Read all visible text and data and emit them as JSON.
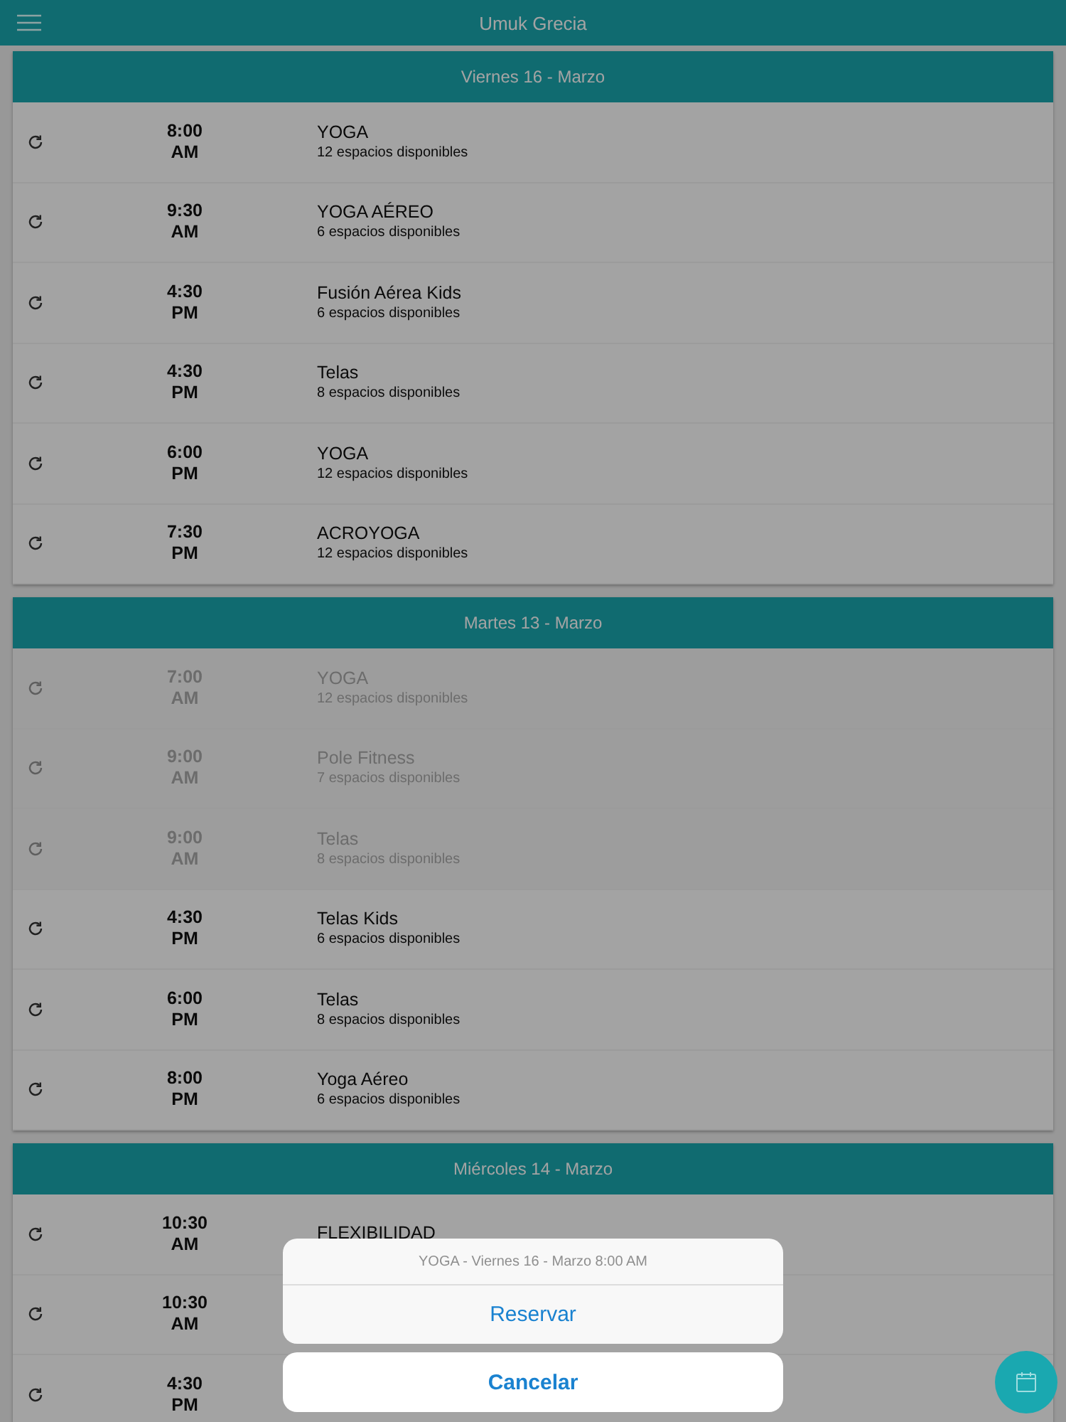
{
  "top_bar": {
    "title": "Umuk Grecia"
  },
  "days": [
    {
      "title": "Viernes 16 - Marzo",
      "classes": [
        {
          "time": "8:00",
          "period": "AM",
          "name": "YOGA",
          "spaces": "12 espacios disponibles",
          "past": false
        },
        {
          "time": "9:30",
          "period": "AM",
          "name": "YOGA AÉREO",
          "spaces": "6 espacios disponibles",
          "past": false
        },
        {
          "time": "4:30",
          "period": "PM",
          "name": "Fusión Aérea Kids",
          "spaces": "6 espacios disponibles",
          "past": false
        },
        {
          "time": "4:30",
          "period": "PM",
          "name": "Telas",
          "spaces": "8 espacios disponibles",
          "past": false
        },
        {
          "time": "6:00",
          "period": "PM",
          "name": "YOGA",
          "spaces": "12 espacios disponibles",
          "past": false
        },
        {
          "time": "7:30",
          "period": "PM",
          "name": "ACROYOGA",
          "spaces": "12 espacios disponibles",
          "past": false
        }
      ]
    },
    {
      "title": "Martes 13 - Marzo",
      "classes": [
        {
          "time": "7:00",
          "period": "AM",
          "name": "YOGA",
          "spaces": "12 espacios disponibles",
          "past": true
        },
        {
          "time": "9:00",
          "period": "AM",
          "name": "Pole Fitness",
          "spaces": "7 espacios disponibles",
          "past": true
        },
        {
          "time": "9:00",
          "period": "AM",
          "name": "Telas",
          "spaces": "8 espacios disponibles",
          "past": true
        },
        {
          "time": "4:30",
          "period": "PM",
          "name": "Telas Kids",
          "spaces": "6 espacios disponibles",
          "past": false
        },
        {
          "time": "6:00",
          "period": "PM",
          "name": "Telas",
          "spaces": "8 espacios disponibles",
          "past": false
        },
        {
          "time": "8:00",
          "period": "PM",
          "name": "Yoga Aéreo",
          "spaces": "6 espacios disponibles",
          "past": false
        }
      ]
    },
    {
      "title": "Miércoles 14 - Marzo",
      "classes": [
        {
          "time": "10:30",
          "period": "AM",
          "name": "FLEXIBILIDAD",
          "past": false
        },
        {
          "time": "10:30",
          "period": "AM",
          "past": false
        },
        {
          "time": "4:30",
          "period": "PM",
          "past": false
        }
      ]
    }
  ],
  "action_sheet": {
    "title": "YOGA - Viernes 16 - Marzo 8:00 AM",
    "action": "Reservar",
    "cancel": "Cancelar"
  }
}
